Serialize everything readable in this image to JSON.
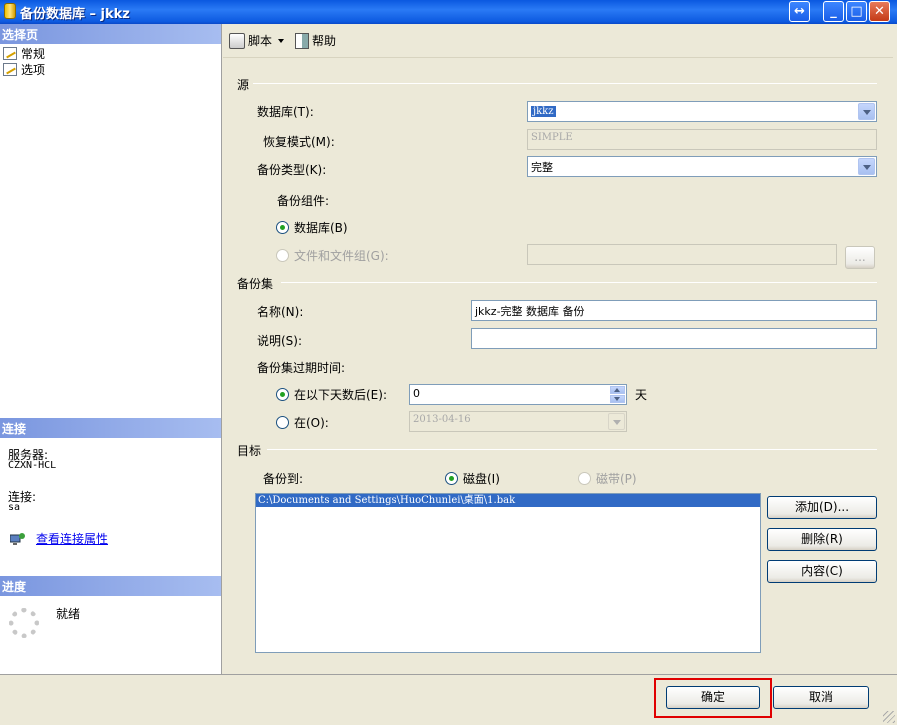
{
  "window": {
    "title": "备份数据库 – jkkz",
    "restore_symbol": "↔",
    "minimize_symbol": "_",
    "maximize_symbol": "□",
    "close_symbol": "✕"
  },
  "left": {
    "select_page_header": "选择页",
    "nav_items": [
      {
        "label": "常规",
        "icon": "page-icon"
      },
      {
        "label": "选项",
        "icon": "page-icon"
      }
    ],
    "connection_header": "连接",
    "server_label": "服务器:",
    "server_value": "CZXN-HCL",
    "connection_label": "连接:",
    "connection_value": "sa",
    "view_props_link": "查看连接属性",
    "progress_header": "进度",
    "progress_status": "就绪"
  },
  "toolbar": {
    "script_label": "脚本",
    "help_label": "帮助"
  },
  "source": {
    "group_title": "源",
    "database_label": "数据库(T):",
    "database_value": "jkkz",
    "recovery_label": "恢复模式(M):",
    "recovery_value": "SIMPLE",
    "backup_type_label": "备份类型(K):",
    "backup_type_value": "完整",
    "component_label": "备份组件:",
    "comp_database_label": "数据库(B)",
    "comp_database_checked": true,
    "comp_files_label": "文件和文件组(G):",
    "comp_files_checked": false,
    "browse_label": "..."
  },
  "backup_set": {
    "group_title": "备份集",
    "name_label": "名称(N):",
    "name_value": "jkkz-完整 数据库 备份",
    "desc_label": "说明(S):",
    "desc_value": "",
    "expire_label": "备份集过期时间:",
    "after_days_label": "在以下天数后(E):",
    "after_days_checked": true,
    "after_days_value": "0",
    "days_unit": "天",
    "on_label": "在(O):",
    "on_checked": false,
    "on_value": "2013-04-16"
  },
  "destination": {
    "group_title": "目标",
    "backup_to_label": "备份到:",
    "disk_label": "磁盘(I)",
    "disk_checked": true,
    "tape_label": "磁带(P)",
    "tape_checked": false,
    "paths": [
      "C:\\Documents and Settings\\HuoChunlei\\桌面\\1.bak"
    ],
    "add_label": "添加(D)...",
    "remove_label": "删除(R)",
    "contents_label": "内容(C)"
  },
  "footer": {
    "ok_label": "确定",
    "cancel_label": "取消",
    "highlight_color": "#e00000"
  }
}
